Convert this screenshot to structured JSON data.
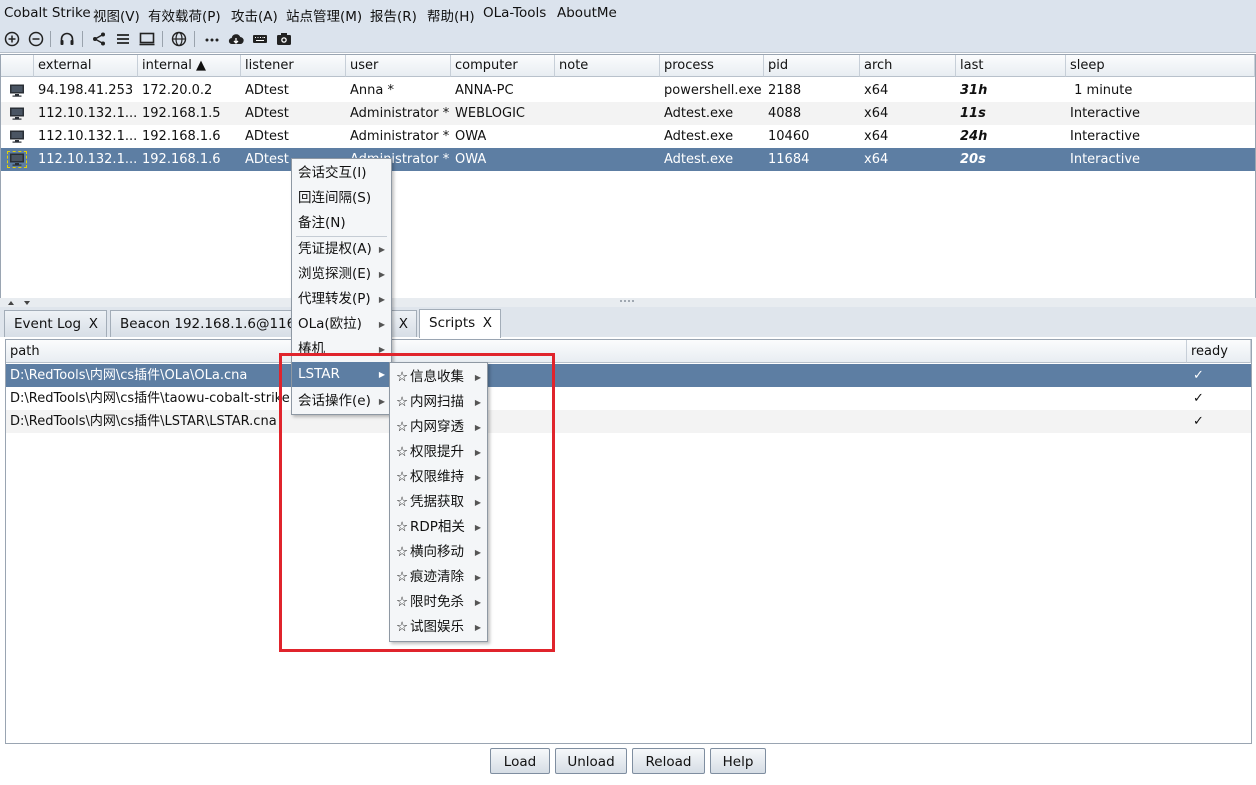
{
  "menubar": [
    "Cobalt Strike",
    "视图(V)",
    "有效载荷(P)",
    "攻击(A)",
    "站点管理(M)",
    "报告(R)",
    "帮助(H)",
    "OLa-Tools",
    "AboutMe"
  ],
  "toolbar_icons": [
    "connect-icon",
    "disconnect-icon",
    "headset-icon",
    "share-icon",
    "list-icon",
    "monitor-icon",
    "globe-icon",
    "dots-icon",
    "cloud-icon",
    "keyboard-icon",
    "camera-icon"
  ],
  "beacons": {
    "columns": [
      "external",
      "internal ▲",
      "listener",
      "user",
      "computer",
      "note",
      "process",
      "pid",
      "arch",
      "last",
      "sleep"
    ],
    "rows": [
      {
        "external": "94.198.41.253",
        "internal": "172.20.0.2",
        "listener": "ADtest",
        "user": "Anna *",
        "computer": "ANNA-PC",
        "note": "",
        "process": "powershell.exe",
        "pid": "2188",
        "arch": "x64",
        "last": "31h",
        "sleep": " 1 minute"
      },
      {
        "external": "112.10.132.1...",
        "internal": "192.168.1.5",
        "listener": "ADtest",
        "user": "Administrator *",
        "computer": "WEBLOGIC",
        "note": "",
        "process": "Adtest.exe",
        "pid": "4088",
        "arch": "x64",
        "last": "11s",
        "sleep": "Interactive"
      },
      {
        "external": "112.10.132.1...",
        "internal": "192.168.1.6",
        "listener": "ADtest",
        "user": "Administrator *",
        "computer": "OWA",
        "note": "",
        "process": "Adtest.exe",
        "pid": "10460",
        "arch": "x64",
        "last": "24h",
        "sleep": "Interactive"
      },
      {
        "external": "112.10.132.1...",
        "internal": "192.168.1.6",
        "listener": "ADtest",
        "user": "Administrator *",
        "computer": "OWA",
        "note": "",
        "process": "Adtest.exe",
        "pid": "11684",
        "arch": "x64",
        "last": "20s",
        "sleep": "Interactive"
      }
    ]
  },
  "tabs": [
    {
      "label": "Event Log",
      "close": "X"
    },
    {
      "label": "Beacon 192.168.1.6@1168",
      "close": "X"
    },
    {
      "label": "Scripts",
      "close": "X"
    }
  ],
  "scripts": {
    "columns": [
      "path",
      "ready"
    ],
    "rows": [
      {
        "path": "D:\\RedTools\\内网\\cs插件\\OLa\\OLa.cna",
        "ready": "✓"
      },
      {
        "path": "D:\\RedTools\\内网\\cs插件\\taowu-cobalt-strike",
        "ready": "✓"
      },
      {
        "path": "D:\\RedTools\\内网\\cs插件\\LSTAR\\LSTAR.cna",
        "ready": "✓"
      }
    ]
  },
  "buttons": [
    "Load",
    "Unload",
    "Reload",
    "Help"
  ],
  "context_menu": [
    "会话交互(I)",
    "回连间隔(S)",
    "备注(N)",
    "凭证提权(A)",
    "浏览探测(E)",
    "代理转发(P)",
    "OLa(欧拉)",
    "椿机",
    "LSTAR",
    "会话操作(e)"
  ],
  "lstar_menu": {
    "star": "☆",
    "items": [
      "信息收集",
      "内网扫描",
      "内网穿透",
      "权限提升",
      "权限维持",
      "凭据获取",
      "RDP相关",
      "横向移动",
      "痕迹清除",
      "限时免杀",
      "试图娱乐"
    ]
  },
  "colors": {
    "selection": "#5d7ea3",
    "highlight": "#e0242c",
    "chrome": "#dbe3ed"
  }
}
